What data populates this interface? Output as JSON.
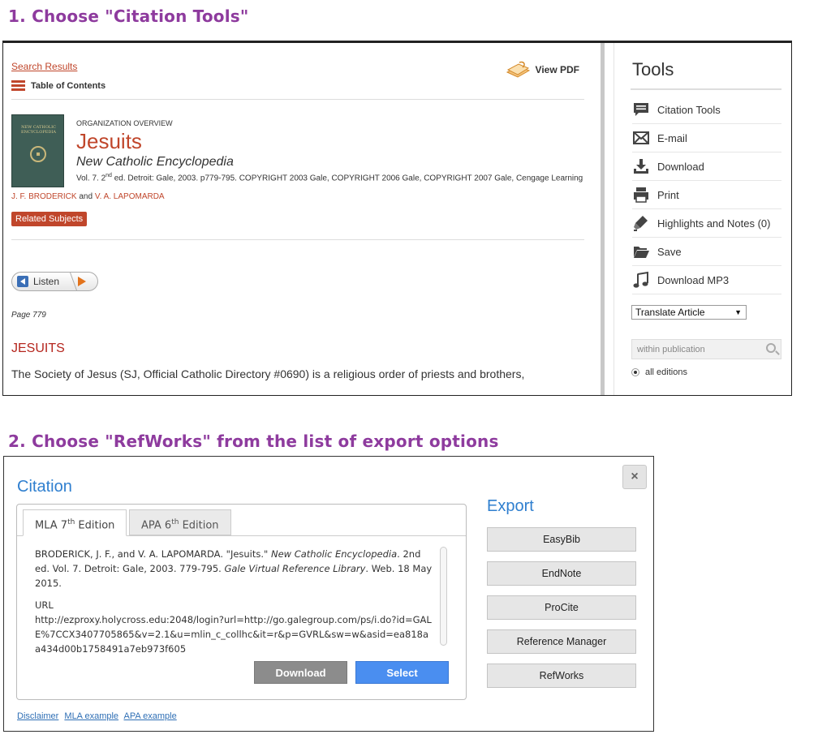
{
  "step1_heading": "1. Choose \"Citation Tools\"",
  "step2_heading": "2. Choose \"RefWorks\" from the list of export options",
  "article": {
    "search_results_link": "Search Results",
    "table_of_contents": "Table of Contents",
    "view_pdf": "View PDF",
    "cover_text": "NEW CATHOLIC ENCYCLOPEDIA",
    "doc_type": "ORGANIZATION OVERVIEW",
    "title": "Jesuits",
    "source": "New Catholic Encyclopedia",
    "citation_pre": "Vol. 7. 2",
    "citation_sup": "nd",
    "citation_post": " ed. Detroit: Gale, 2003. p779-795. COPYRIGHT 2003 Gale, COPYRIGHT 2006 Gale, COPYRIGHT 2007 Gale, Cengage Learning",
    "author1": "J. F. BRODERICK",
    "author_and": " and ",
    "author2": "V. A. LAPOMARDA",
    "related_subjects": "Related Subjects",
    "listen": "Listen",
    "page": "Page 779",
    "section_heading": "JESUITS",
    "body_text": "The Society of Jesus (SJ, Official Catholic Directory #0690) is a religious order of priests and brothers,"
  },
  "tools": {
    "title": "Tools",
    "items": [
      {
        "label": "Citation Tools",
        "icon": "citation-icon"
      },
      {
        "label": "E-mail",
        "icon": "email-icon"
      },
      {
        "label": "Download",
        "icon": "download-icon"
      },
      {
        "label": "Print",
        "icon": "print-icon"
      },
      {
        "label": "Highlights and Notes (0)",
        "icon": "highlight-icon"
      },
      {
        "label": "Save",
        "icon": "folder-icon"
      },
      {
        "label": "Download MP3",
        "icon": "music-icon"
      }
    ],
    "translate": "Translate Article",
    "search_placeholder": "within publication",
    "all_editions": "all editions"
  },
  "citation": {
    "title": "Citation",
    "close": "×",
    "tabs": [
      {
        "pre": "MLA 7",
        "sup": "th",
        "post": " Edition"
      },
      {
        "pre": "APA 6",
        "sup": "th",
        "post": " Edition"
      }
    ],
    "text_a": "BRODERICK, J. F., and V. A. LAPOMARDA. \"Jesuits.\" ",
    "text_b": "New Catholic Encyclopedia",
    "text_c": ". 2nd ed. Vol. 7. Detroit: Gale, 2003. 779-795. ",
    "text_d": "Gale Virtual Reference Library",
    "text_e": ". Web. 18 May 2015.",
    "url_label": "URL",
    "url": "http://ezproxy.holycross.edu:2048/login?url=http://go.galegroup.com/ps/i.do?id=GALE%7CCX3407705865&v=2.1&u=mlin_c_collhc&it=r&p=GVRL&sw=w&asid=ea818aa434d00b1758491a7eb973f605",
    "download": "Download",
    "select": "Select",
    "export_title": "Export",
    "export_options": [
      "EasyBib",
      "EndNote",
      "ProCite",
      "Reference Manager",
      "RefWorks"
    ],
    "footer_links": [
      "Disclaimer",
      "MLA example",
      "APA example"
    ]
  }
}
